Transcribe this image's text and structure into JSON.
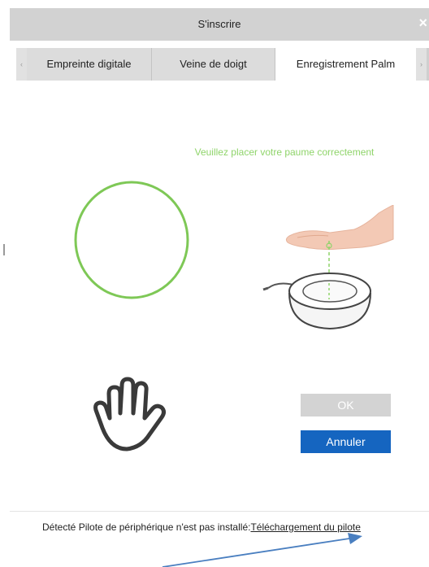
{
  "window": {
    "title": "S'inscrire",
    "close_glyph": "×"
  },
  "tabs": [
    {
      "label": "Empreinte digitale",
      "active": false
    },
    {
      "label": "Veine de doigt",
      "active": false
    },
    {
      "label": "Enregistrement Palm",
      "active": true
    }
  ],
  "nav": {
    "prev_glyph": "‹",
    "next_glyph": "›"
  },
  "instruction": "Veuillez placer votre paume correctement",
  "buttons": {
    "ok_label": "OK",
    "cancel_label": "Annuler"
  },
  "footer": {
    "message": "Détecté Pilote de périphérique n'est pas installé:",
    "link": "Téléchargement du pilote"
  },
  "colors": {
    "accent_green": "#8fd46a",
    "ring_green": "#7ec856",
    "primary_blue": "#1565c0",
    "disabled_gray": "#d3d3d3",
    "annotation_arrow": "#4a7fc0"
  },
  "icons": [
    "close-icon",
    "palm-scan-ring",
    "palm-scanner-illustration",
    "hand-icon",
    "annotation-arrow"
  ]
}
